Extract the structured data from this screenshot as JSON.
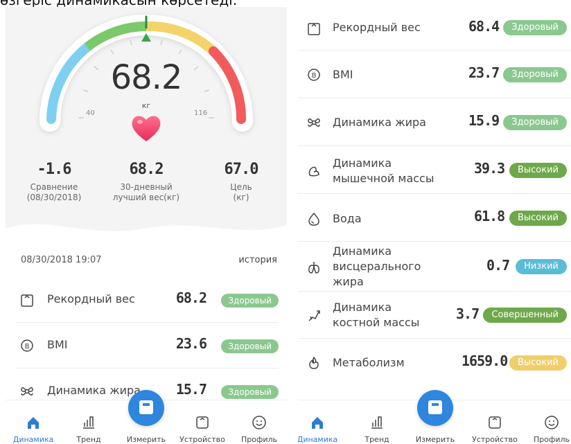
{
  "caption": "өзгеріс динамикасын көрсетеді.",
  "colors": {
    "healthy": "#8bc88f",
    "high": "#6fa84a",
    "low": "#5bbcd8",
    "perfect": "#6fa84a",
    "high_yellow": "#f0cf6b",
    "accent_blue": "#2e86de"
  },
  "left": {
    "gauge": {
      "value": "68.2",
      "unit": "кг",
      "min_label": "40",
      "max_label": "116"
    },
    "stats": [
      {
        "value": "-1.6",
        "label1": "Сравнение",
        "label2": "(08/30/2018)"
      },
      {
        "value": "68.2",
        "label1": "30-дневный",
        "label2": "лучший вес(кг)"
      },
      {
        "value": "67.0",
        "label1": "Цель",
        "label2": "(кг)"
      }
    ],
    "date": "08/30/2018 19:07",
    "history": "история",
    "metrics": [
      {
        "icon": "scale-record-icon",
        "name": "Рекордный вес",
        "value": "68.2",
        "status": "Здоровый"
      },
      {
        "icon": "bmi-icon",
        "name": "BMI",
        "value": "23.6",
        "status": "Здоровый"
      },
      {
        "icon": "fat-icon",
        "name": "Динамика жира",
        "value": "15.7",
        "status": "Здоровый"
      }
    ]
  },
  "right": {
    "metrics": [
      {
        "icon": "scale-record-icon",
        "name1": "Рекордный вес",
        "name2": "",
        "name3": "",
        "value": "68.4",
        "status": "Здоровый",
        "kind": "healthy"
      },
      {
        "icon": "bmi-icon",
        "name1": "BMI",
        "name2": "",
        "name3": "",
        "value": "23.7",
        "status": "Здоровый",
        "kind": "healthy"
      },
      {
        "icon": "fat-icon",
        "name1": "Динамика жира",
        "name2": "",
        "name3": "",
        "value": "15.9",
        "status": "Здоровый",
        "kind": "healthy"
      },
      {
        "icon": "muscle-icon",
        "name1": "Динамика",
        "name2": "мышечной массы",
        "name3": "",
        "value": "39.3",
        "status": "Высокий",
        "kind": "high"
      },
      {
        "icon": "water-icon",
        "name1": "Вода",
        "name2": "",
        "name3": "",
        "value": "61.8",
        "status": "Высокий",
        "kind": "high"
      },
      {
        "icon": "visceral-fat-icon",
        "name1": "Динамика",
        "name2": "висцерального",
        "name3": "жира",
        "value": "0.7",
        "status": "Низкий",
        "kind": "low"
      },
      {
        "icon": "bone-icon",
        "name1": "Динамика",
        "name2": "костной массы",
        "name3": "",
        "value": "3.7",
        "status": "Совершенный",
        "kind": "perfect"
      },
      {
        "icon": "metabolism-icon",
        "name1": "Метаболизм",
        "name2": "",
        "name3": "",
        "value": "1659.0",
        "status": "Высокий",
        "kind": "high_yellow"
      }
    ]
  },
  "nav": {
    "items": [
      "Динамика",
      "Тренд",
      "Измерить",
      "Устройство",
      "Профиль"
    ]
  }
}
